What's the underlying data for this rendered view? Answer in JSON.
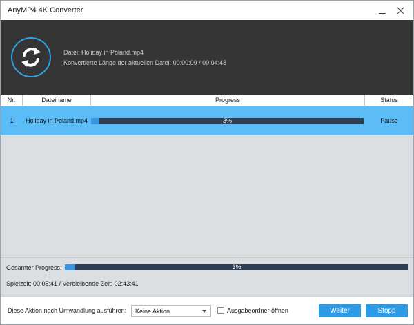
{
  "window": {
    "title": "AnyMP4 4K Converter"
  },
  "header": {
    "file_line": "Datei: Holiday in Poland.mp4",
    "length_line": "Konvertierte Länge der aktuellen Datei: 00:00:09 / 00:04:48",
    "icon": "convert-refresh-icon",
    "accent_color": "#2fa3e6"
  },
  "table": {
    "columns": {
      "nr": "Nr.",
      "name": "Dateiname",
      "progress": "Progress",
      "status": "Status"
    },
    "rows": [
      {
        "nr": "1",
        "name": "Holiday in Poland.mp4",
        "progress_label": "3%",
        "progress_value": 0.03,
        "status": "Pause"
      }
    ],
    "selected_row_color": "#5bbcf6"
  },
  "total": {
    "label": "Gesamter Progress:",
    "progress_label": "3%",
    "progress_value": 0.03,
    "time_line": "Spielzeit: 00:05:41 / Verbleibende Zeit: 02:43:41"
  },
  "footer": {
    "action_label": "Diese Aktion nach Umwandlung ausführen:",
    "action_value": "Keine Aktion",
    "checkbox_label": "Ausgabeordner öffnen",
    "checkbox_checked": false,
    "weiter_label": "Weiter",
    "stopp_label": "Stopp",
    "button_color": "#2d9ae6"
  }
}
